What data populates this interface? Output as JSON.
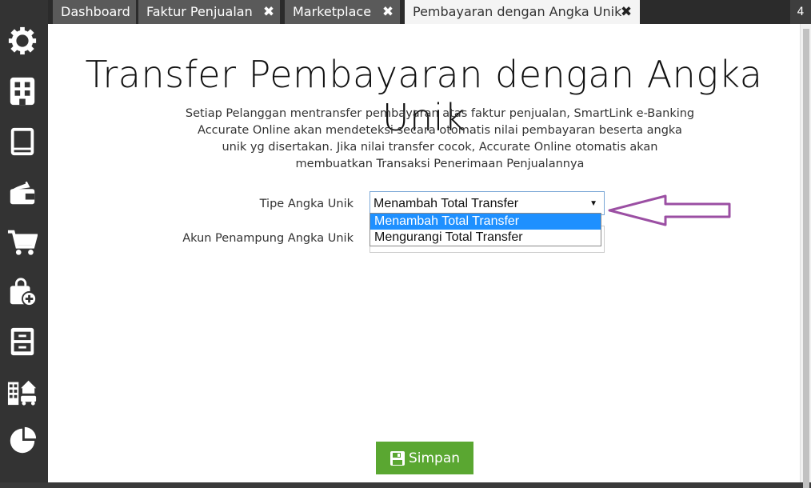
{
  "tabs": [
    {
      "label": "Dashboard",
      "closable": false
    },
    {
      "label": "Faktur Penjualan",
      "closable": true
    },
    {
      "label": "Marketplace",
      "closable": true
    },
    {
      "label": "Pembayaran dengan Angka Unik",
      "closable": true,
      "active": true
    }
  ],
  "tab_count": "4",
  "sidebar": {
    "icons": [
      "settings-gear-icon",
      "company-building-icon",
      "ledger-book-icon",
      "wallet-icon",
      "cart-icon",
      "purchase-bag-icon",
      "inventory-cabinet-icon",
      "asset-property-icon",
      "report-pie-icon"
    ]
  },
  "page": {
    "title": "Transfer Pembayaran dengan Angka Unik",
    "description_lines": [
      "Setiap Pelanggan mentransfer pembayaran atas faktur penjualan, SmartLink e-Banking",
      "Accurate Online akan mendeteksi secara otomatis nilai pembayaran beserta angka",
      "unik yg disertakan. Jika nilai transfer cocok, Accurate Online otomatis akan",
      "membuatkan Transaksi Penerimaan Penjualannya"
    ]
  },
  "form": {
    "tipe_label": "Tipe Angka Unik",
    "tipe_value": "Menambah Total Transfer",
    "tipe_options": [
      "Menambah Total Transfer",
      "Mengurangi Total Transfer"
    ],
    "akun_label": "Akun Penampung Angka Unik",
    "akun_value": ""
  },
  "save_label": "Simpan",
  "colors": {
    "save_button": "#5aa731",
    "selected_option": "#1e90ff",
    "annotation_arrow": "#9b4fa3"
  }
}
